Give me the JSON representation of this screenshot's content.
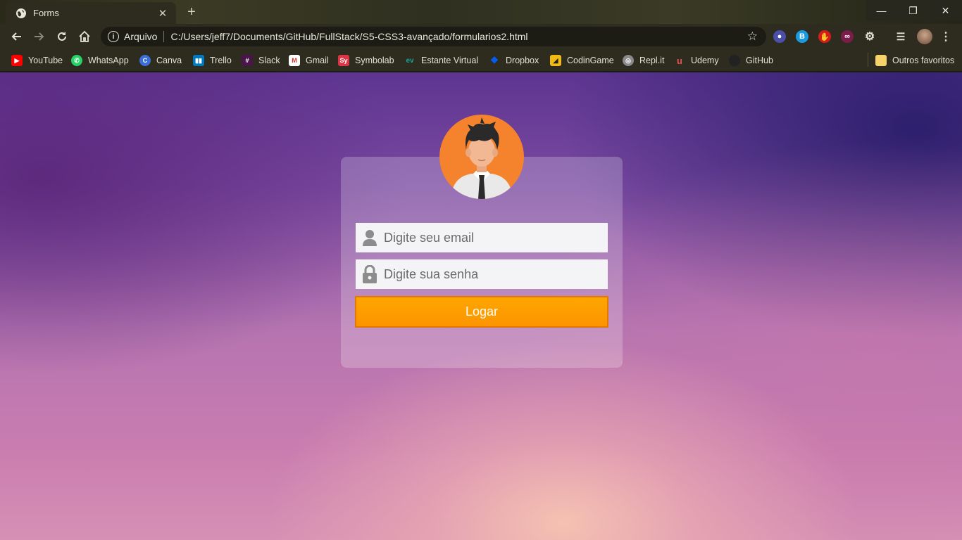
{
  "browser": {
    "tab_title": "Forms",
    "address": {
      "security_label": "Arquivo",
      "url": "C:/Users/jeff7/Documents/GitHub/FullStack/S5-CSS3-avançado/formularios2.html"
    },
    "bookmarks": [
      {
        "label": "YouTube",
        "icon": "youtube-icon",
        "color": "#ff0000"
      },
      {
        "label": "WhatsApp",
        "icon": "whatsapp-icon",
        "color": "#25d366"
      },
      {
        "label": "Canva",
        "icon": "canva-icon",
        "color": "#3b6fd8"
      },
      {
        "label": "Trello",
        "icon": "trello-icon",
        "color": "#0079bf"
      },
      {
        "label": "Slack",
        "icon": "slack-icon",
        "color": "#e01e5a"
      },
      {
        "label": "Gmail",
        "icon": "gmail-icon",
        "color": "#d93025"
      },
      {
        "label": "Symbolab",
        "icon": "symbolab-icon",
        "color": "#dc3545"
      },
      {
        "label": "Estante Virtual",
        "icon": "estante-virtual-icon",
        "color": "#1aa39a"
      },
      {
        "label": "Dropbox",
        "icon": "dropbox-icon",
        "color": "#0061ff"
      },
      {
        "label": "CodinGame",
        "icon": "codingame-icon",
        "color": "#f2bb13"
      },
      {
        "label": "Repl.it",
        "icon": "replit-icon",
        "color": "#8a8a8a"
      },
      {
        "label": "Udemy",
        "icon": "udemy-icon",
        "color": "#ec5252"
      },
      {
        "label": "GitHub",
        "icon": "github-icon",
        "color": "#222222"
      }
    ],
    "other_bookmarks": "Outros favoritos"
  },
  "login": {
    "email_placeholder": "Digite seu email",
    "password_placeholder": "Digite sua senha",
    "submit_label": "Logar",
    "button_color": "#ffa000",
    "avatar_color": "#f5822d"
  }
}
